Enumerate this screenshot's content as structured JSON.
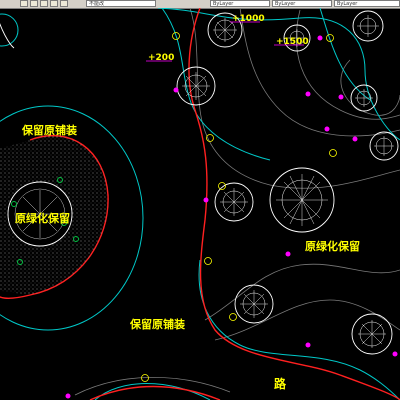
{
  "window": {
    "toolbar_select_1": "不能改",
    "toolbar_select_2": "ByLayer",
    "toolbar_select_3": "ByLayer",
    "toolbar_select_4": "ByLayer"
  },
  "drawing": {
    "background": "#000000",
    "annotations": {
      "label_preserve_paving_top": "保留原铺装",
      "label_original_green_left": "原绿化保留",
      "label_original_green_right": "原绿化保留",
      "label_preserve_paving_bottom": "保留原铺装",
      "label_road": "路",
      "elev_plus_1000": "+1000",
      "elev_plus_1500": "+1500",
      "elev_plus_200": "+200"
    },
    "colors": {
      "label_yellow": "#ffff00",
      "elevation_text": "#ffff00",
      "elevation_marker": "#ff00ff",
      "contour_cyan": "#00c8c8",
      "boundary_red": "#ff2020",
      "tree_white": "#ffffff",
      "hatch_dots": "#a0a0a0",
      "grid_gray": "#7a7a7a",
      "node_green": "#00c040"
    }
  }
}
